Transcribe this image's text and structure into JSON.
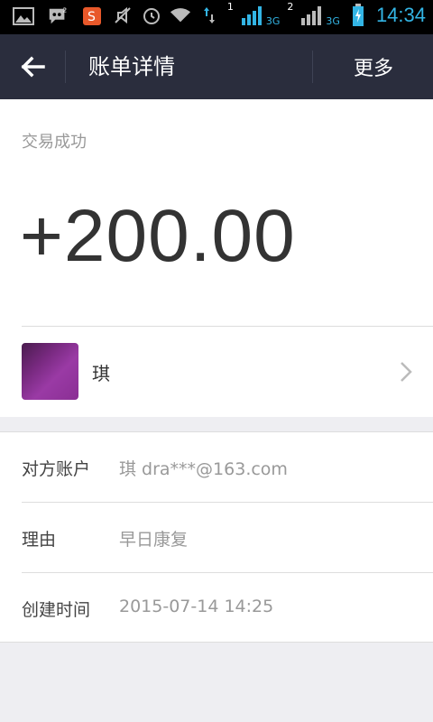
{
  "statusbar": {
    "time": "14:34",
    "sim1": "1",
    "sim2": "2",
    "net1": "3G",
    "net2": "3G",
    "icons": [
      "picture-icon",
      "messenger-icon",
      "sogou-icon",
      "mute-icon",
      "alarm-icon",
      "wifi-icon",
      "data-arrows-icon",
      "signal-icon",
      "signal-icon",
      "battery-charging-icon"
    ]
  },
  "header": {
    "title": "账单详情",
    "more_label": "更多"
  },
  "transaction": {
    "status": "交易成功",
    "amount": "+200.00"
  },
  "contact": {
    "name": "琪"
  },
  "details": [
    {
      "label": "对方账户",
      "value": "琪 dra***@163.com"
    },
    {
      "label": "理由",
      "value": "早日康复"
    },
    {
      "label": "创建时间",
      "value": "2015-07-14 14:25"
    }
  ],
  "colors": {
    "titlebar_bg": "#2a2d3d",
    "accent": "#33b5e5",
    "page_bg": "#eeeef2"
  }
}
